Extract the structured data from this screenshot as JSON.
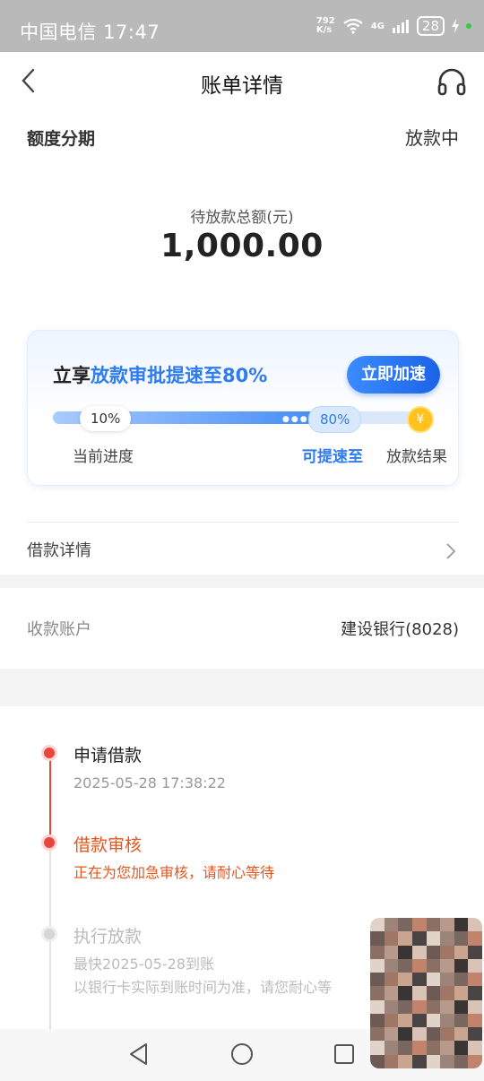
{
  "status_bar": {
    "carrier_time": "中国电信 17:47",
    "speed_top": "792",
    "speed_unit": "K/s",
    "network": "4G",
    "battery": "28"
  },
  "header": {
    "title": "账单详情",
    "back_icon": "chevron-left-icon",
    "service_icon": "headset-icon"
  },
  "summary": {
    "type": "额度分期",
    "status": "放款中",
    "amount_label": "待放款总额(元)",
    "amount": "1,000.00"
  },
  "promo": {
    "headline_prefix": "立享",
    "headline_highlight": "放款审批提速至80%",
    "button": "立即加速",
    "progress_current": "10%",
    "progress_boost": "80%",
    "progress_value": 0.1,
    "boost_value": 0.8,
    "label_current": "当前进度",
    "label_boost": "可提速至",
    "label_result": "放款结果",
    "coin_symbol": "¥"
  },
  "loan_detail": {
    "label": "借款详情"
  },
  "account": {
    "label": "收款账户",
    "value": "建设银行(8028)"
  },
  "timeline": [
    {
      "title": "申请借款",
      "sub": "2025-05-28 17:38:22",
      "state": "done"
    },
    {
      "title": "借款审核",
      "sub": "正在为您加急审核，请耐心等待",
      "state": "active"
    },
    {
      "title": "执行放款",
      "sub": "最快2025-05-28到账",
      "sub2": "以银行卡实际到账时间为准，请您耐心等",
      "state": "pending"
    }
  ],
  "colors": {
    "accent_blue": "#2f7bf0",
    "active_orange": "#e8541c",
    "timeline_red": "#e8453c"
  }
}
